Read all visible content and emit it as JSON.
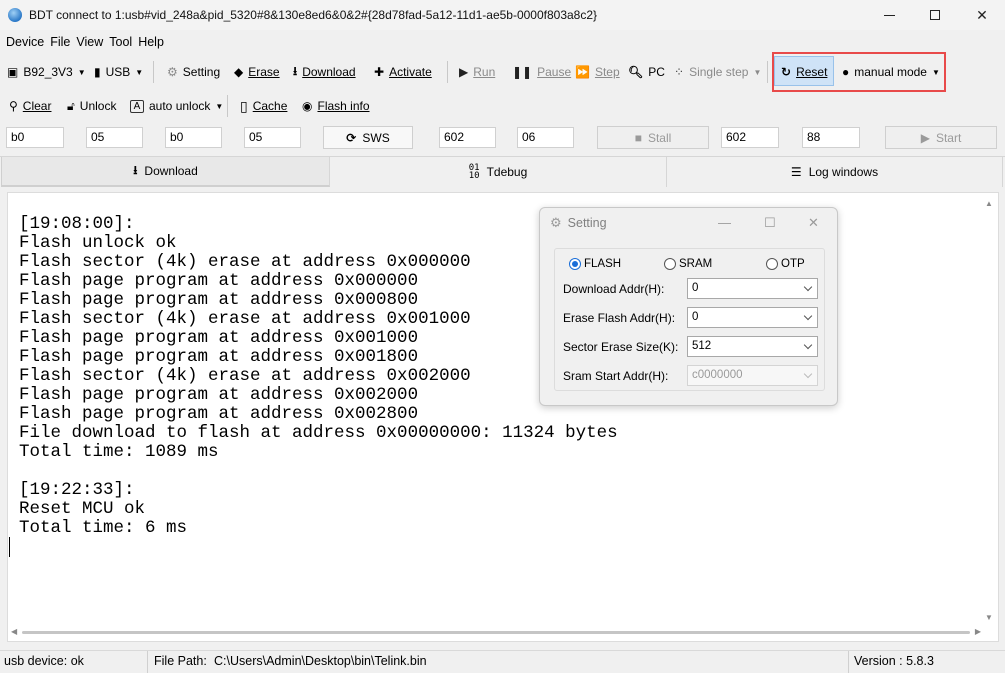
{
  "window": {
    "title": "BDT connect to 1:usb#vid_248a&pid_5320#8&130e8ed6&0&2#{28d78fad-5a12-11d1-ae5b-0000f803a8c2}"
  },
  "menu": [
    "Device",
    "File",
    "View",
    "Tool",
    "Help"
  ],
  "toolbar1": {
    "chip": "B92_3V3",
    "interface": "USB",
    "setting": "Setting",
    "erase": "Erase",
    "download": "Download",
    "activate": "Activate",
    "run": "Run",
    "pause": "Pause",
    "step": "Step",
    "pc": "PC",
    "single_step": "Single step",
    "reset": "Reset",
    "mode": "manual mode"
  },
  "toolbar2": {
    "clear": "Clear",
    "unlock": "Unlock",
    "auto_unlock": "auto unlock",
    "cache": "Cache",
    "flash_info": "Flash info"
  },
  "fields": {
    "f1": "b0",
    "f2": "05",
    "f3": "b0",
    "f4": "05",
    "sws": "SWS",
    "f5": "602",
    "f6": "06",
    "stall": "Stall",
    "f7": "602",
    "f8": "88",
    "start": "Start"
  },
  "tabs": {
    "download": "Download",
    "tdebug": "Tdebug",
    "log_windows": "Log windows"
  },
  "log": "\n[19:08:00]:\nFlash unlock ok\nFlash sector (4k) erase at address 0x000000\nFlash page program at address 0x000000\nFlash page program at address 0x000800\nFlash sector (4k) erase at address 0x001000\nFlash page program at address 0x001000\nFlash page program at address 0x001800\nFlash sector (4k) erase at address 0x002000\nFlash page program at address 0x002000\nFlash page program at address 0x002800\nFile download to flash at address 0x00000000: 11324 bytes\nTotal time: 1089 ms\n\n[19:22:33]:\nReset MCU ok\nTotal time: 6 ms",
  "status": {
    "device": "usb device: ok",
    "file_path_label": "File Path:",
    "file_path": "C:\\Users\\Admin\\Desktop\\bin\\Telink.bin",
    "version": "Version : 5.8.3"
  },
  "setting_dialog": {
    "title": "Setting",
    "radio_flash": "FLASH",
    "radio_sram": "SRAM",
    "radio_otp": "OTP",
    "download_addr_label": "Download  Addr(H):",
    "download_addr": "0",
    "erase_addr_label": "Erase Flash Addr(H):",
    "erase_addr": "0",
    "sector_size_label": "Sector Erase Size(K):",
    "sector_size": "512",
    "sram_start_label": "Sram Start Addr(H):",
    "sram_start": "c0000000"
  }
}
